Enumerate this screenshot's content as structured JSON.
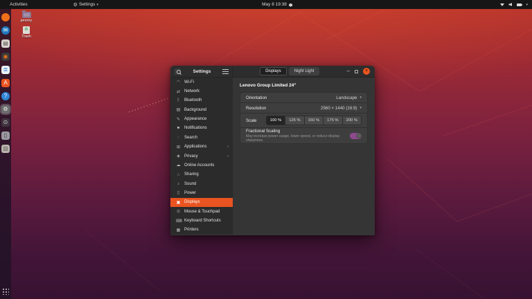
{
  "colors": {
    "accent": "#e95420",
    "toggle_track": "#8e4a8e",
    "topbar_bg": "#161616"
  },
  "icons": {
    "gear": "⚙",
    "caret_down": "▾",
    "chevron_right": "›",
    "close": "×",
    "minimize": "–",
    "recycle": "♻"
  },
  "topbar": {
    "activities": "Activities",
    "app_menu": "Settings",
    "clock": "May 8 19:38",
    "indicators": [
      "wifi-icon",
      "volume-icon",
      "battery-icon"
    ]
  },
  "desktop": {
    "icons": [
      {
        "id": "home-folder",
        "label": "jeremy"
      },
      {
        "id": "trash",
        "label": "Trash"
      }
    ]
  },
  "dock": {
    "items": [
      {
        "id": "firefox",
        "glyph": "",
        "class": "circle",
        "bg": "#f0701a",
        "fg": "#2b4b8f"
      },
      {
        "id": "thunderbird",
        "glyph": "✉",
        "class": "circle",
        "bg": "#1f79c0",
        "fg": "#ffffff"
      },
      {
        "id": "files",
        "glyph": "▤",
        "bg": "#d8d4cf",
        "fg": "#5a5550"
      },
      {
        "id": "rhythmbox",
        "glyph": "◉",
        "bg": "#3a3a3a",
        "fg": "#e8731a"
      },
      {
        "id": "libreoffice-writer",
        "glyph": "≣",
        "bg": "#e9f2fa",
        "fg": "#1565c0"
      },
      {
        "id": "ubuntu-software",
        "glyph": "A",
        "bg": "#e95420",
        "fg": "#ffffff"
      },
      {
        "id": "help",
        "glyph": "?",
        "class": "circle",
        "bg": "#2f86d6",
        "fg": "#ffffff"
      },
      {
        "id": "settings",
        "glyph": "⚙",
        "class": "active",
        "bg": "#6d6d6d",
        "fg": "#efefef"
      },
      {
        "id": "screenshot",
        "glyph": "⊙",
        "bg": "#40343e",
        "fg": "#d8d8d8"
      },
      {
        "id": "phone-device",
        "glyph": "▯",
        "bg": "#9a9aa0",
        "fg": "#3a3a40"
      },
      {
        "id": "sdcard-device",
        "glyph": "▨",
        "bg": "#b9b4ae",
        "fg": "#6a645e"
      }
    ]
  },
  "window": {
    "title": "Settings",
    "tabs": [
      {
        "id": "displays",
        "label": "Displays",
        "selected": true
      },
      {
        "id": "night-light",
        "label": "Night Light"
      }
    ],
    "controls": {
      "minimize": "–",
      "close": "×"
    },
    "sidebar": {
      "items": [
        {
          "id": "wifi",
          "glyph": "◠",
          "label": "Wi-Fi"
        },
        {
          "id": "network",
          "glyph": "⇄",
          "label": "Network"
        },
        {
          "id": "bluetooth",
          "glyph": "ᛒ",
          "label": "Bluetooth"
        },
        {
          "id": "background",
          "glyph": "▤",
          "label": "Background"
        },
        {
          "id": "appearance",
          "glyph": "✎",
          "label": "Appearance"
        },
        {
          "id": "notifications",
          "glyph": "⚑",
          "label": "Notifications"
        },
        {
          "id": "search",
          "glyph": "◌",
          "label": "Search"
        },
        {
          "id": "applications",
          "glyph": "⊞",
          "label": "Applications",
          "chevron": "›"
        },
        {
          "id": "privacy",
          "glyph": "◈",
          "label": "Privacy",
          "chevron": "›"
        },
        {
          "id": "online-accounts",
          "glyph": "☁",
          "label": "Online Accounts"
        },
        {
          "id": "sharing",
          "glyph": "∴",
          "label": "Sharing"
        },
        {
          "id": "sound",
          "glyph": "♪",
          "label": "Sound"
        },
        {
          "id": "power",
          "glyph": "▯",
          "label": "Power"
        },
        {
          "id": "displays",
          "glyph": "▣",
          "label": "Displays",
          "selected": true
        },
        {
          "id": "mouse-touchpad",
          "glyph": "⊙",
          "label": "Mouse & Touchpad"
        },
        {
          "id": "keyboard-shortcuts",
          "glyph": "⌨",
          "label": "Keyboard Shortcuts"
        },
        {
          "id": "printers",
          "glyph": "▦",
          "label": "Printers"
        }
      ]
    },
    "panel": {
      "monitor_title": "Lenovo Group Limited 24\"",
      "orientation": {
        "label": "Orientation",
        "value": "Landscape"
      },
      "resolution": {
        "label": "Resolution",
        "value": "2560 × 1440 (16:9)"
      },
      "scale": {
        "label": "Scale",
        "options": [
          {
            "label": "100 %",
            "selected": true
          },
          {
            "label": "125 %"
          },
          {
            "label": "150 %"
          },
          {
            "label": "175 %"
          },
          {
            "label": "200 %"
          }
        ]
      },
      "fractional": {
        "label": "Fractional Scaling",
        "subtitle": "May increase power usage, lower speed, or reduce display sharpness.",
        "enabled": true
      }
    }
  }
}
